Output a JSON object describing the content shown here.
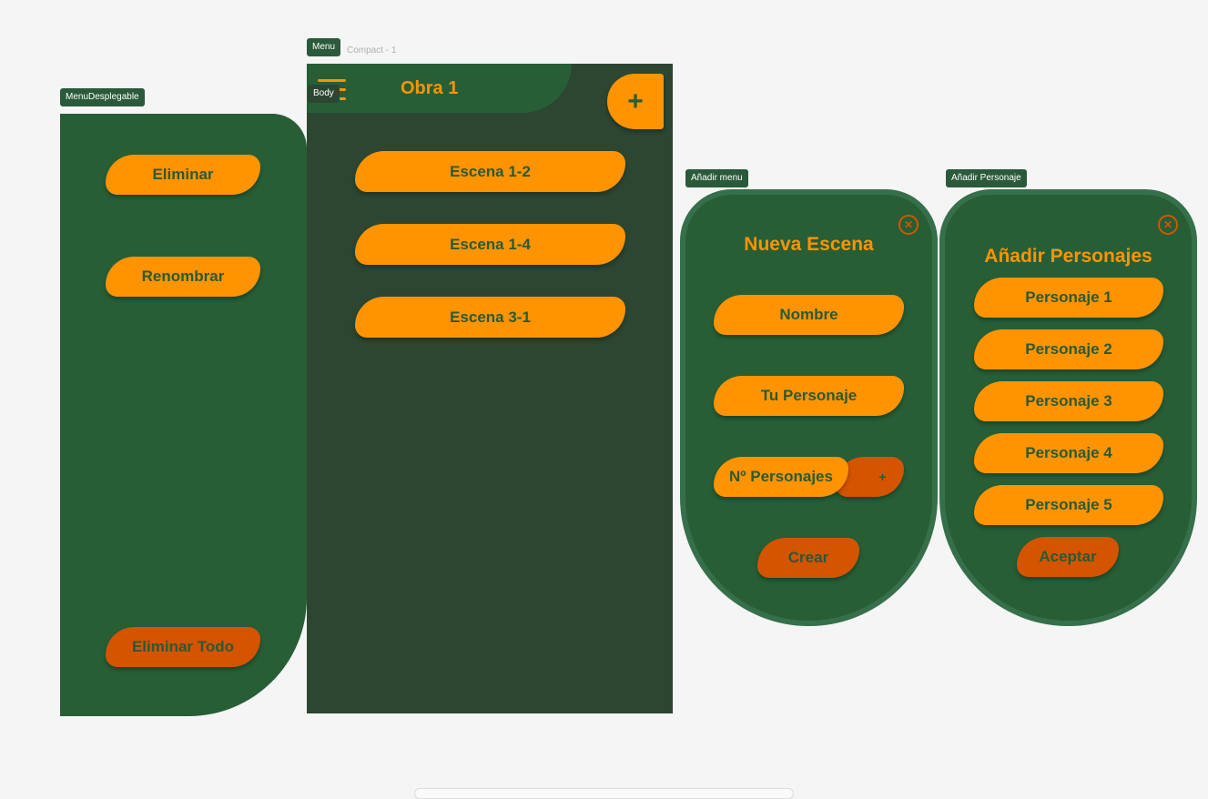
{
  "labels": {
    "menu_desplegable": "MenuDesplegable",
    "menu": "Menu",
    "compact": "Compact - 1",
    "body": "Body",
    "anadir_menu": "Añadir menu",
    "anadir_personaje": "Añadir Personaje"
  },
  "menu_desplegable": {
    "items": [
      "Eliminar",
      "Renombrar"
    ],
    "delete_all": "Eliminar Todo"
  },
  "compact": {
    "title": "Obra 1",
    "add_button": "+",
    "scenes": [
      "Escena 1-2",
      "Escena 1-4",
      "Escena 3-1"
    ]
  },
  "nueva_escena": {
    "title": "Nueva Escena",
    "close": "✕",
    "nombre": "Nombre",
    "tu_personaje": "Tu Personaje",
    "num_personajes": "Nº Personajes",
    "plus": "+",
    "crear": "Crear"
  },
  "anadir_personajes": {
    "title": "Añadir Personajes",
    "close": "✕",
    "characters": [
      "Personaje 1",
      "Personaje 2",
      "Personaje 3",
      "Personaje 4",
      "Personaje 5"
    ],
    "aceptar": "Aceptar"
  },
  "colors": {
    "primary_green": "#275e36",
    "dark_green": "#2c4632",
    "orange": "#ff9400",
    "red_orange": "#d45400",
    "background": "#f5f5f5"
  },
  "icons": {
    "hamburger": "hamburger-icon",
    "add": "plus-icon",
    "close": "close-circle-icon"
  }
}
